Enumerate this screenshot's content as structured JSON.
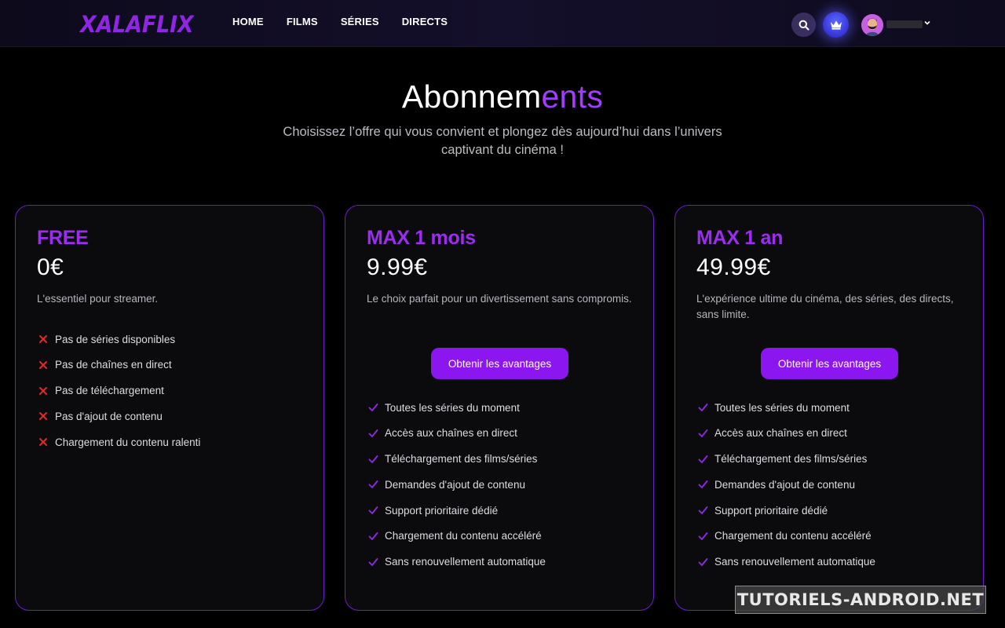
{
  "header": {
    "logo": "XALAFLIX",
    "nav": [
      "HOME",
      "FILMS",
      "SÉRIES",
      "DIRECTS"
    ],
    "search_icon": "search-icon",
    "premium_icon": "crown-icon",
    "avatar_icon": "user-avatar"
  },
  "hero": {
    "title_main": "Abonnem",
    "title_accent": "ents",
    "subtitle": "Choisissez l’offre qui vous convient et plongez dès aujourd’hui dans l’univers captivant du cinéma !"
  },
  "plans": [
    {
      "name": "FREE",
      "price": "0€",
      "description": "L'essentiel pour streamer.",
      "features": [
        "Pas de séries disponibles",
        "Pas de chaînes en direct",
        "Pas de téléchargement",
        "Pas d'ajout de contenu",
        "Chargement du contenu ralenti"
      ]
    },
    {
      "name": "MAX 1 mois",
      "price": "9.99€",
      "description": "Le choix parfait pour un divertissement sans compromis.",
      "cta": "Obtenir les avantages",
      "features": [
        "Toutes les séries du moment",
        "Accès aux chaînes en direct",
        "Téléchargement des films/séries",
        "Demandes d'ajout de contenu",
        "Support prioritaire dédié",
        "Chargement du contenu accéléré",
        "Sans renouvellement automatique"
      ]
    },
    {
      "name": "MAX 1 an",
      "price": "49.99€",
      "description": "L'expérience ultime du cinéma, des séries, des directs, sans limite.",
      "cta": "Obtenir les avantages",
      "features": [
        "Toutes les séries du moment",
        "Accès aux chaînes en direct",
        "Téléchargement des films/séries",
        "Demandes d'ajout de contenu",
        "Support prioritaire dédié",
        "Chargement du contenu accéléré",
        "Sans renouvellement automatique"
      ]
    }
  ],
  "colors": {
    "accent": "#9b2cf0",
    "button": "#8c16f0",
    "card_border": "#6a1ecf",
    "cross": "#e02a2a",
    "check": "#8f2be0"
  },
  "watermark": "TUTORIELS-ANDROID.NET"
}
